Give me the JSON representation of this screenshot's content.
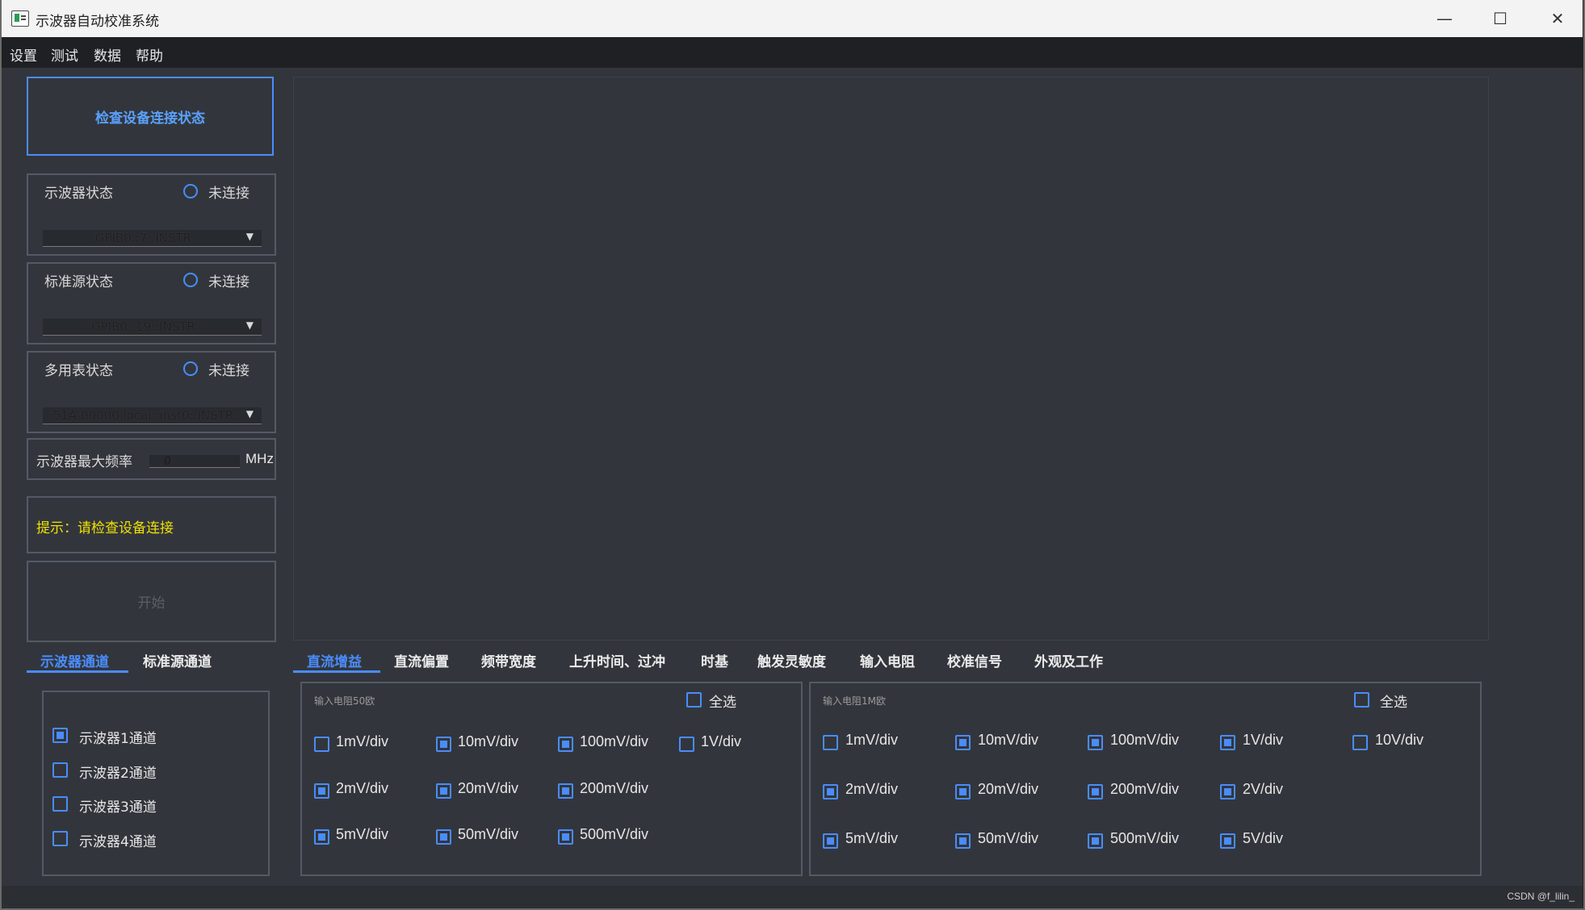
{
  "window": {
    "title": "示波器自动校准系统",
    "controls": {
      "minimize": "—",
      "maximize": "☐",
      "close": "✕"
    }
  },
  "menu": [
    "设置",
    "测试",
    "数据",
    "帮助"
  ],
  "left": {
    "check_button": "检查设备连接状态",
    "devices": [
      {
        "label": "示波器状态",
        "status": "未连接",
        "address": "GPIB0::7::INSTR"
      },
      {
        "label": "标准源状态",
        "status": "未连接",
        "address": "GPIB0::19::INSTR"
      },
      {
        "label": "多用表状态",
        "status": "未连接",
        "address": "51A-00000.local::inst0::INSTR"
      }
    ],
    "max_freq": {
      "label": "示波器最大频率",
      "value": "0",
      "unit": "MHz"
    },
    "hint": "提示：请检查设备连接",
    "start_button": "开始"
  },
  "channel_tabs": [
    "示波器通道",
    "标准源通道"
  ],
  "channels": [
    {
      "label": "示波器1通道",
      "checked": true
    },
    {
      "label": "示波器2通道",
      "checked": false
    },
    {
      "label": "示波器3通道",
      "checked": false
    },
    {
      "label": "示波器4通道",
      "checked": false
    }
  ],
  "test_tabs": [
    "直流增益",
    "直流偏置",
    "频带宽度",
    "上升时间、过冲",
    "时基",
    "触发灵敏度",
    "输入电阻",
    "校准信号",
    "外观及工作"
  ],
  "group50": {
    "title": "输入电阻50欧",
    "select_all": "全选",
    "items": [
      {
        "label": "1mV/div",
        "checked": false
      },
      {
        "label": "10mV/div",
        "checked": true
      },
      {
        "label": "100mV/div",
        "checked": true
      },
      {
        "label": "1V/div",
        "checked": false
      },
      {
        "label": "2mV/div",
        "checked": true
      },
      {
        "label": "20mV/div",
        "checked": true
      },
      {
        "label": "200mV/div",
        "checked": true
      },
      {
        "label": "5mV/div",
        "checked": true
      },
      {
        "label": "50mV/div",
        "checked": true
      },
      {
        "label": "500mV/div",
        "checked": true
      }
    ]
  },
  "group1m": {
    "title": "输入电阻1M欧",
    "select_all": "全选",
    "items": [
      {
        "label": "1mV/div",
        "checked": false
      },
      {
        "label": "10mV/div",
        "checked": true
      },
      {
        "label": "100mV/div",
        "checked": true
      },
      {
        "label": "1V/div",
        "checked": true
      },
      {
        "label": "10V/div",
        "checked": false
      },
      {
        "label": "2mV/div",
        "checked": true
      },
      {
        "label": "20mV/div",
        "checked": true
      },
      {
        "label": "200mV/div",
        "checked": true
      },
      {
        "label": "2V/div",
        "checked": true
      },
      {
        "label": "5mV/div",
        "checked": true
      },
      {
        "label": "50mV/div",
        "checked": true
      },
      {
        "label": "500mV/div",
        "checked": true
      },
      {
        "label": "5V/div",
        "checked": true
      }
    ]
  },
  "watermark": "CSDN @f_lilin_",
  "colors": {
    "accent": "#4a8cff",
    "hint": "#f0e000",
    "background": "#32363c",
    "menubar": "#1e2024"
  }
}
